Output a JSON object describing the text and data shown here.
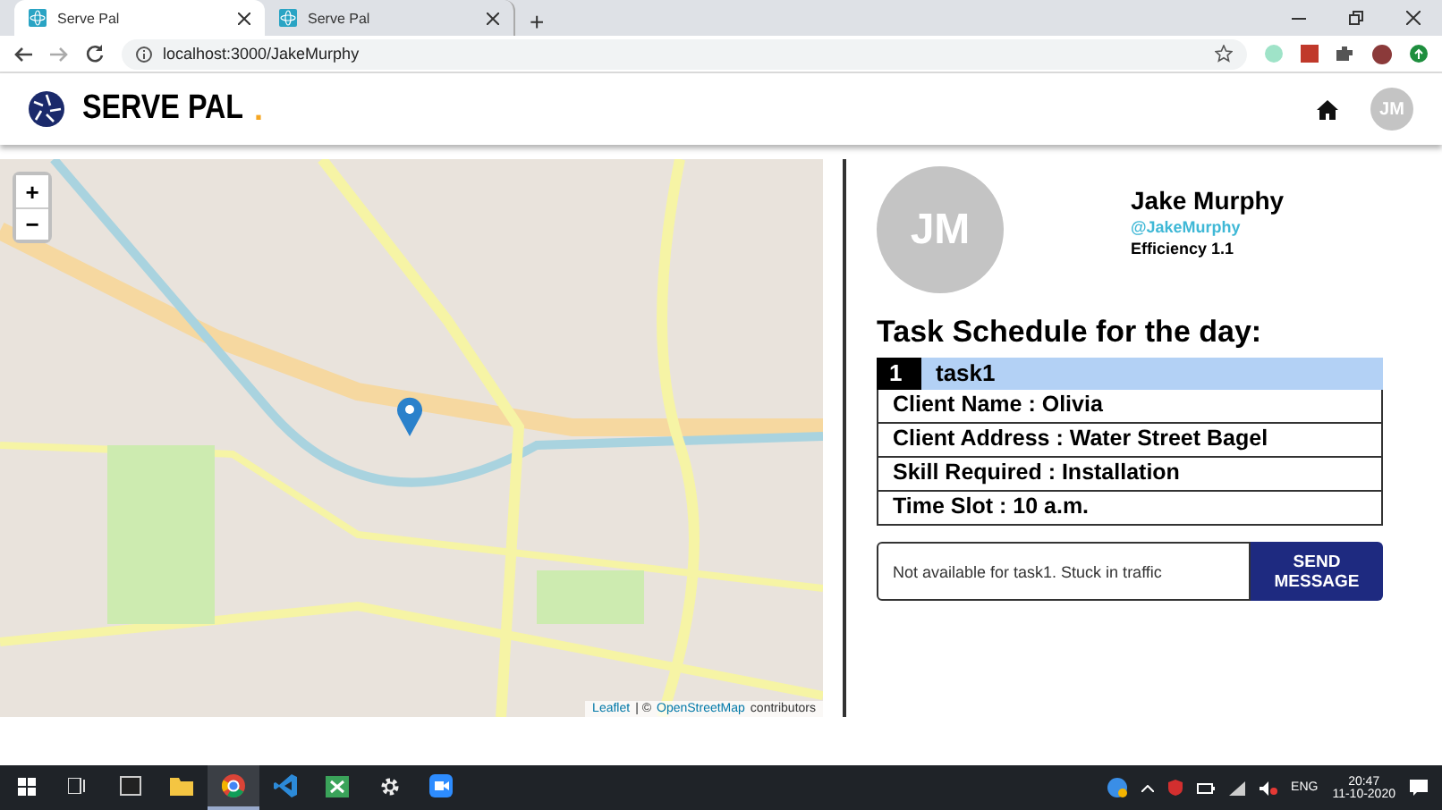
{
  "browser": {
    "tabs": [
      {
        "title": "Serve Pal",
        "selected": true
      },
      {
        "title": "Serve Pal",
        "selected": false
      }
    ],
    "new_tab": "+",
    "address": "localhost:3000/JakeMurphy"
  },
  "header": {
    "brand": "SERVE PAL",
    "brand_dot": ".",
    "avatar": "JM"
  },
  "map": {
    "zoom_in": "+",
    "zoom_out": "−",
    "attribution": [
      {
        "kind": "link",
        "text": "Leaflet"
      },
      {
        "kind": "text",
        "text": "| ©"
      },
      {
        "kind": "link",
        "text": "OpenStreetMap"
      },
      {
        "kind": "text",
        "text": "contributors"
      }
    ]
  },
  "profile": {
    "initials": "JM",
    "name": "Jake Murphy",
    "handle": "@JakeMurphy",
    "efficiency": "Efficiency 1.1"
  },
  "schedule": {
    "title": "Task Schedule for the day:",
    "tasks": [
      {
        "number": "1",
        "name": "task1",
        "details": [
          "Client Name : Olivia",
          "Client Address : Water Street Bagel",
          "Skill Required : Installation",
          "Time Slot : 10 a.m."
        ]
      }
    ]
  },
  "message": {
    "value": "Not available for task1. Stuck in traffic",
    "button": "SEND MESSAGE"
  },
  "taskbar": {
    "apps": [
      {
        "kind": "taskview",
        "selected": false
      },
      {
        "kind": "window",
        "selected": false
      },
      {
        "kind": "folder",
        "selected": false
      },
      {
        "kind": "browser",
        "selected": true
      },
      {
        "kind": "code",
        "selected": false
      },
      {
        "kind": "sheet",
        "selected": false
      },
      {
        "kind": "gear",
        "selected": false
      },
      {
        "kind": "video",
        "selected": false
      }
    ],
    "language": "ENG",
    "time": "20:47",
    "date": "11-10-2020"
  }
}
